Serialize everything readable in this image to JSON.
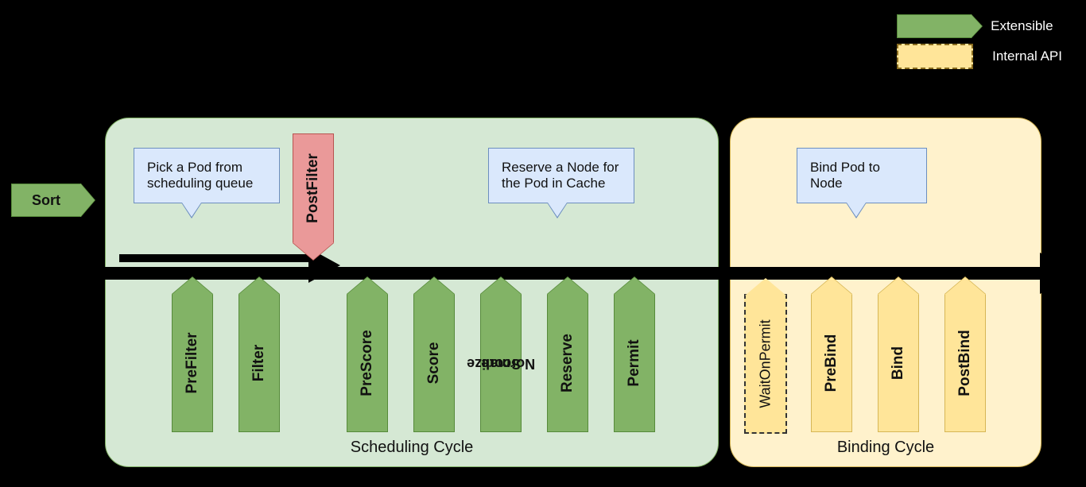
{
  "legend": {
    "extensible": "Extensible",
    "internal": "Internal API"
  },
  "sort": "Sort",
  "cycles": {
    "scheduling": "Scheduling Cycle",
    "binding": "Binding Cycle"
  },
  "callouts": {
    "pick": "Pick a Pod from scheduling queue",
    "reserve": "Reserve a Node for the Pod in Cache",
    "bind": "Bind Pod to Node"
  },
  "plugins": {
    "prefilter": "PreFilter",
    "filter": "Filter",
    "postfilter": "PostFilter",
    "prescore": "PreScore",
    "score": "Score",
    "normalizescore_l1": "Normalize",
    "normalizescore_l2": "Score",
    "reserve": "Reserve",
    "permit": "Permit",
    "waitonpermit": "WaitOnPermit",
    "prebind": "PreBind",
    "bind": "Bind",
    "postbind": "PostBind"
  }
}
